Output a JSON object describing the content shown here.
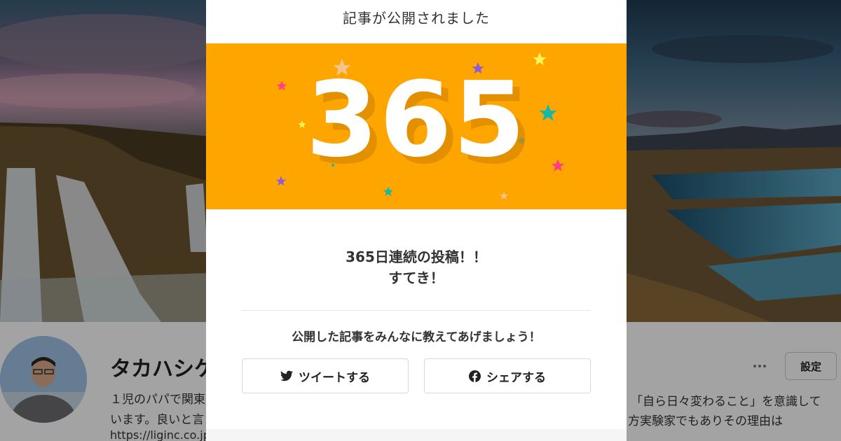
{
  "modal": {
    "title": "記事が公開されました",
    "streak_number": "365",
    "message_line1": "365日連続の投稿！！",
    "message_line2": "すてき！",
    "share_prompt": "公開した記事をみんなに教えてあげましょう！",
    "tweet_label": "ツイートする",
    "share_label": "シェアする",
    "banner_color": "#ffa500"
  },
  "profile": {
    "name": "タカハシケ",
    "bio_left_line1": "１児のパパで関東",
    "bio_left_line2": "います。良いと言",
    "url": "https://liginc.co.jp",
    "bio_right_line1": "「自ら日々変わること」を意識して",
    "bio_right_line2": "方実験家でもありその理由は",
    "settings_label": "設定"
  },
  "icons": {
    "tweet": "twitter-bird-icon",
    "share": "facebook-icon",
    "more": "more-dots-icon"
  }
}
